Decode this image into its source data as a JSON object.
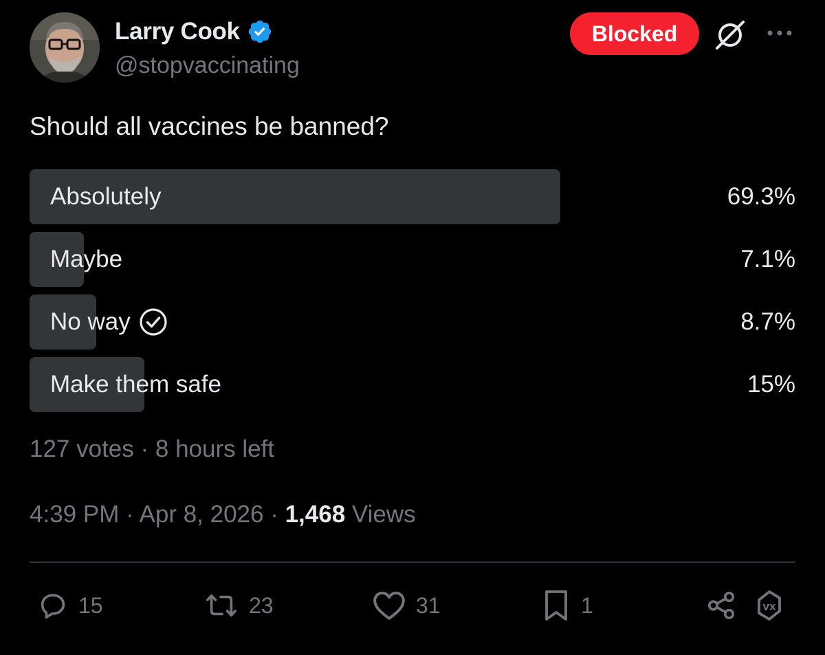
{
  "author": {
    "name": "Larry Cook",
    "handle": "@stopvaccinating",
    "verified_color": "#1d9bf0"
  },
  "header": {
    "blocked_label": "Blocked",
    "blocked_color": "#f4212e"
  },
  "post": {
    "text": "Should all vaccines be banned?"
  },
  "poll": {
    "options": [
      {
        "label": "Absolutely",
        "percent": "69.3%",
        "fraction": 0.693,
        "selected": false
      },
      {
        "label": "Maybe",
        "percent": "7.1%",
        "fraction": 0.071,
        "selected": false
      },
      {
        "label": "No way",
        "percent": "8.7%",
        "fraction": 0.087,
        "selected": true
      },
      {
        "label": "Make them safe",
        "percent": "15%",
        "fraction": 0.15,
        "selected": false
      }
    ],
    "meta": "127 votes · 8 hours left"
  },
  "timestamp": {
    "time_date": "4:39 PM · Apr 8, 2026 · ",
    "views_count": "1,468",
    "views_label": " Views"
  },
  "actions": {
    "reply_count": "15",
    "repost_count": "23",
    "like_count": "31",
    "bookmark_count": "1"
  },
  "icons": [
    "verified-badge-icon",
    "grok-icon",
    "more-icon",
    "check-circle-icon",
    "reply-icon",
    "repost-icon",
    "like-icon",
    "bookmark-icon",
    "share-icon",
    "vx-icon"
  ]
}
